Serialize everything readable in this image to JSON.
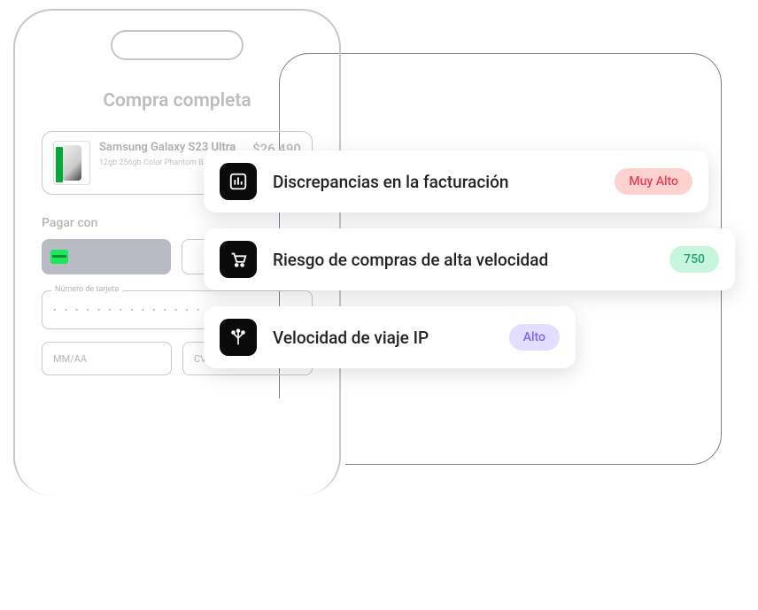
{
  "phone": {
    "title": "Compra completa",
    "product": {
      "name": "Samsung Galaxy S23 Ultra",
      "sub": "12gb 256gb Color Phantom Black",
      "price": "$26,490"
    },
    "pay_label": "Pagar con",
    "card_number_label": "Número de tarjeta",
    "card_dots": "•  •  •  •   •  •  •  •   •  •  •  •   •  •  •  •",
    "expiry_placeholder": "MM/AA",
    "cvc_placeholder": "CVC"
  },
  "risks": [
    {
      "icon": "chart-icon",
      "title": "Discrepancias en la facturación",
      "badge_text": "Muy Alto",
      "badge_class": "red"
    },
    {
      "icon": "cart-icon",
      "title": "Riesgo de compras de alta velocidad",
      "badge_text": "750",
      "badge_class": "green"
    },
    {
      "icon": "network-icon",
      "title": "Velocidad de viaje IP",
      "badge_text": "Alto",
      "badge_class": "purple"
    }
  ]
}
